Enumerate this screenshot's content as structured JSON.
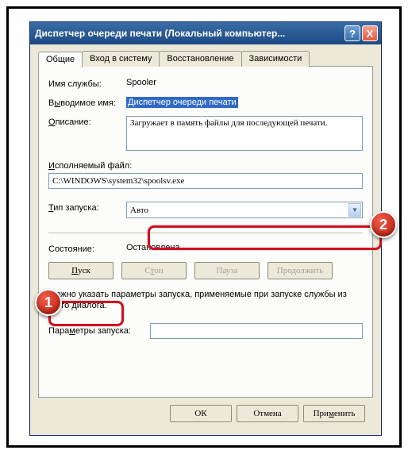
{
  "titlebar": {
    "text": "Диспетчер очереди печати (Локальный компьютер...",
    "help": "?",
    "close": "X"
  },
  "tabs": {
    "general": "Общие",
    "logon": "Вход в систему",
    "recovery": "Восстановление",
    "deps": "Зависимости"
  },
  "labels": {
    "service_name": "Имя службы:",
    "display_name_pre": "В",
    "display_name_u": "ы",
    "display_name_post": "водимое имя:",
    "description_u": "О",
    "description_post": "писание:",
    "exe_u": "И",
    "exe_post": "сполняемый файл:",
    "startup_u": "Т",
    "startup_post": "ип запуска:",
    "state": "Состояние:",
    "start_u": "П",
    "start_post": "уск",
    "stop_pre": "С",
    "stop_u": "т",
    "stop_post": "оп",
    "pause": "Пауза",
    "resume": "Продолжить",
    "note": "Можно указать параметры запуска, применяемые при запуске службы из этого диалога.",
    "params_pre": "Пара",
    "params_u": "м",
    "params_post": "етры запуска:",
    "ok": "ОК",
    "cancel": "Отмена",
    "apply_pre": "При",
    "apply_u": "м",
    "apply_post": "енить"
  },
  "values": {
    "service_name": "Spooler",
    "display_name": "Диспетчер очереди печати",
    "description": "Загружает в память файлы для последующей печати.",
    "exe_path": "C:\\WINDOWS\\system32\\spoolsv.exe",
    "startup": "Авто",
    "state": "Остановлена",
    "params": ""
  },
  "badges": {
    "b1": "1",
    "b2": "2"
  }
}
